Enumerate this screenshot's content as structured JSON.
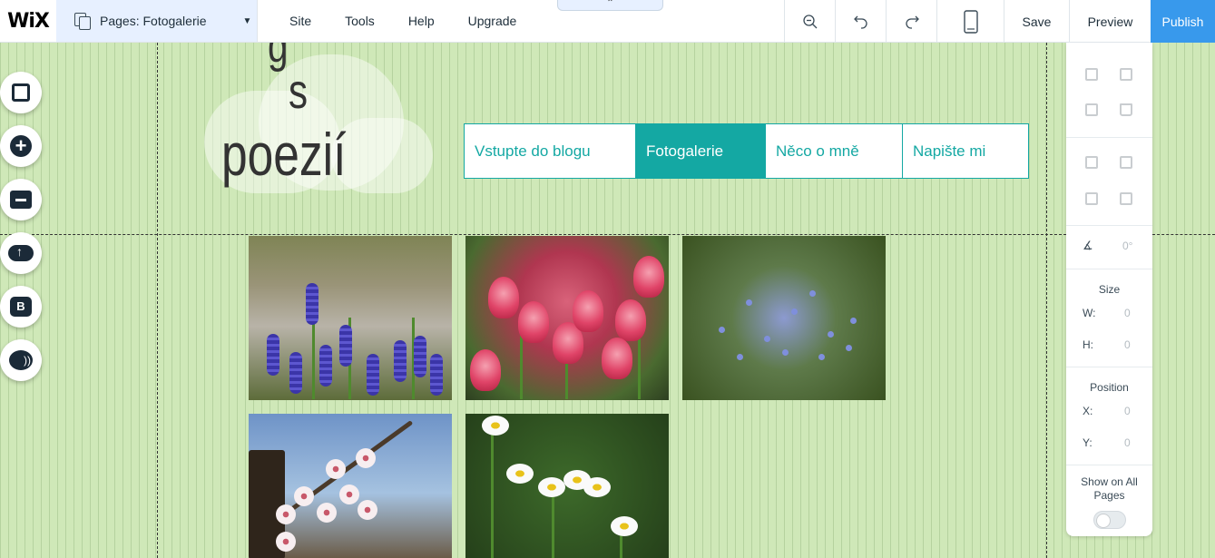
{
  "topbar": {
    "logo": "WiX",
    "pages_label": "Pages: Fotogalerie",
    "menu": [
      "Site",
      "Tools",
      "Help",
      "Upgrade"
    ],
    "save_label": "Save",
    "preview_label": "Preview",
    "publish_label": "Publish",
    "icons": [
      "zoom-out-icon",
      "undo-icon",
      "redo-icon",
      "mobile-icon"
    ]
  },
  "left_tools": [
    "background-icon",
    "add-icon",
    "app-market-icon",
    "upload-icon",
    "blog-icon",
    "chat-icon"
  ],
  "site": {
    "title_line1": "g",
    "title_line2": "s",
    "title_line3": "poezií",
    "nav": [
      {
        "label": "Vstupte do blogu",
        "active": false
      },
      {
        "label": "Fotogalerie",
        "active": true
      },
      {
        "label": "Něco o mně",
        "active": false
      },
      {
        "label": "Napište mi",
        "active": false
      }
    ],
    "accent_color": "#14a8a3"
  },
  "gallery": {
    "photos": [
      "grape-hyacinth-photo",
      "tulips-photo",
      "blue-flowers-photo",
      "almond-blossom-photo",
      "daisies-photo"
    ]
  },
  "inspector": {
    "rotation": "0°",
    "size_label": "Size",
    "w_label": "W:",
    "w_value": "0",
    "h_label": "H:",
    "h_value": "0",
    "position_label": "Position",
    "x_label": "X:",
    "x_value": "0",
    "y_label": "Y:",
    "y_value": "0",
    "show_on_all_pages_label": "Show on All Pages"
  }
}
